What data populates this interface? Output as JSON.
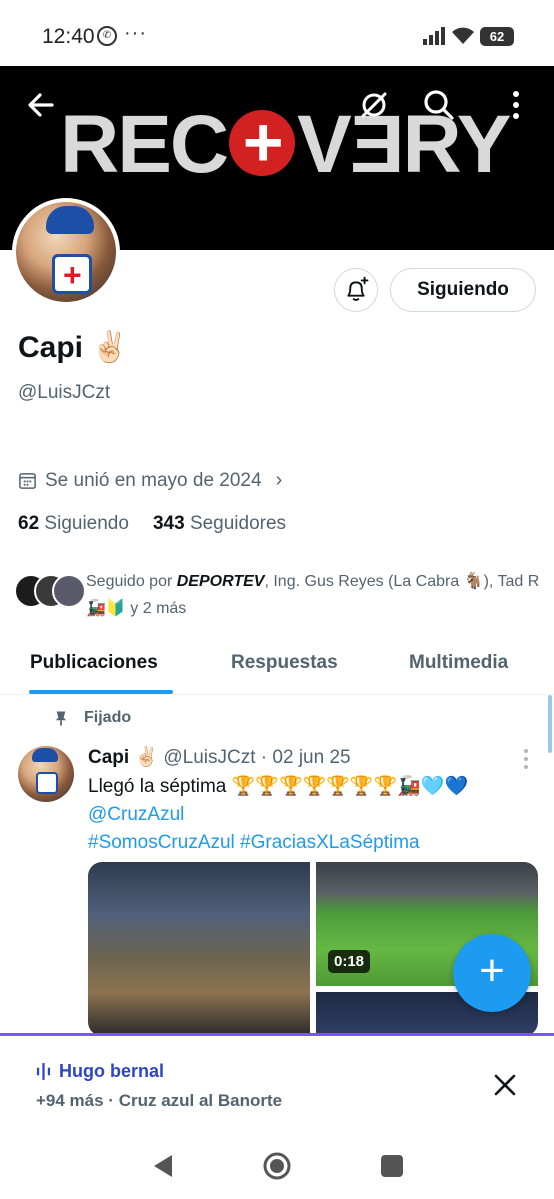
{
  "status_bar": {
    "time": "12:40",
    "more_indicator": "···",
    "battery": "62",
    "icons": [
      "whatsapp-icon",
      "signal-icon",
      "wifi-icon",
      "battery-icon"
    ]
  },
  "banner": {
    "text_left": "REC",
    "text_cross": "+",
    "text_right": "VƎRY"
  },
  "header_icons": [
    "back-arrow-icon",
    "translate-icon",
    "search-icon",
    "more-vertical-icon"
  ],
  "profile": {
    "display_name": "Capi ✌🏻",
    "handle": "@LuisJCzt",
    "joined": "Se unió en mayo de 2024",
    "following_count": "62",
    "following_label": "Siguiendo",
    "followers_count": "343",
    "followers_label": "Seguidores",
    "follow_button": "Siguiendo",
    "followed_by_prefix": "Seguido por ",
    "followed_by_bold": "DEPORTEV",
    "followed_by_rest": ", Ing. Gus Reyes (La Cabra 🐐), Tad R 🚂🔰 y 2 más"
  },
  "tabs": [
    "Publicaciones",
    "Respuestas",
    "Multimedia"
  ],
  "pinned_label": "Fijado",
  "tweet": {
    "name": "Capi ✌🏻",
    "handle_date": "@LuisJCzt · 02 jun 25",
    "text": "Llegó la séptima 🏆🏆🏆🏆🏆🏆🏆🚂🩵💙",
    "mention": "@CruzAzul",
    "hashtags": "#SomosCruzAzul #GraciasXLaSéptima",
    "video_duration": "0:18"
  },
  "fab_label": "+",
  "space_bar": {
    "host": "Hugo bernal",
    "subtitle": "+94 más · Cruz azul al Banorte"
  },
  "colors": {
    "accent": "#1d9bf0",
    "space_purple": "#7856ff",
    "banner_red": "#d32020",
    "muted_text": "#536471"
  }
}
